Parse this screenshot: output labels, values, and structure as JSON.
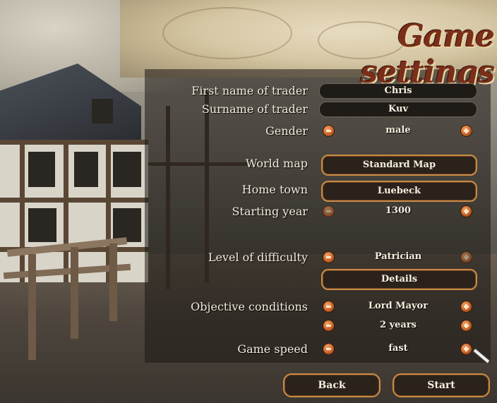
{
  "title": "Game settings",
  "fields": {
    "first_name": {
      "label": "First name of trader",
      "value": "Chris"
    },
    "surname": {
      "label": "Surname of trader",
      "value": "Kuv"
    },
    "gender": {
      "label": "Gender",
      "value": "male"
    },
    "world_map": {
      "label": "World map",
      "value": "Standard Map"
    },
    "home_town": {
      "label": "Home town",
      "value": "Luebeck"
    },
    "starting_year": {
      "label": "Starting year",
      "value": "1300"
    },
    "difficulty": {
      "label": "Level of difficulty",
      "value": "Patrician",
      "details": "Details"
    },
    "objective": {
      "label": "Objective conditions",
      "value": "Lord Mayor",
      "duration": "2 years"
    },
    "game_speed": {
      "label": "Game speed",
      "value": "fast"
    }
  },
  "buttons": {
    "back": "Back",
    "start": "Start"
  },
  "colors": {
    "accent": "#c98b47",
    "title": "#7a2f1a",
    "arrow": "#c9642a"
  },
  "icons": {
    "decrease": "minus-circle-icon",
    "increase": "plus-circle-icon",
    "cursor": "mouse-pointer-icon"
  }
}
